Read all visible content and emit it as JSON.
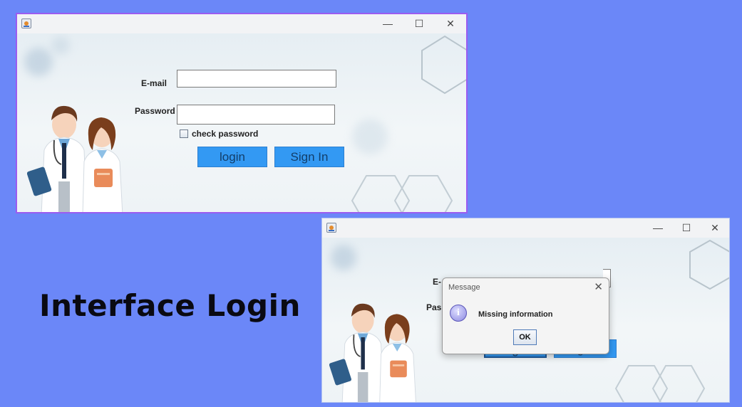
{
  "caption": "Interface Login",
  "window_controls": {
    "minimize": "—",
    "maximize": "☐",
    "close": "✕"
  },
  "login_form": {
    "email_label": "E-mail",
    "email_value": "",
    "password_label": "Password",
    "password_value": "",
    "check_password_label": "check password",
    "check_password_checked": false,
    "login_button": "login",
    "signin_button": "Sign In"
  },
  "second_window": {
    "email_label_partial": "E-",
    "password_label_partial": "Pass",
    "login_button": "login",
    "signin_button": "Sign In"
  },
  "dialog": {
    "title": "Message",
    "close_label": "✕",
    "icon": "info-icon",
    "message": "Missing information",
    "ok_label": "OK"
  },
  "colors": {
    "page_background": "#6b87f8",
    "window1_border": "#9b5cf0",
    "button_blue": "#3399f3"
  }
}
